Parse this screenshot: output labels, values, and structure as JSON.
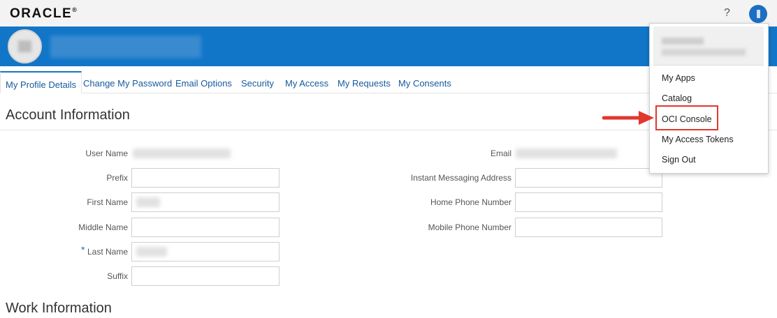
{
  "header": {
    "logo_text": "ORACLE",
    "logo_mark": "®",
    "help_label": "?"
  },
  "tabs": [
    {
      "label": "My Profile Details",
      "active": true
    },
    {
      "label": "Change My Password"
    },
    {
      "label": "Email Options"
    },
    {
      "label": "Security"
    },
    {
      "label": "My Access"
    },
    {
      "label": "My Requests"
    },
    {
      "label": "My Consents"
    }
  ],
  "sections": {
    "account": "Account Information",
    "work": "Work Information"
  },
  "form": {
    "left": [
      {
        "label": "User Name"
      },
      {
        "label": "Prefix"
      },
      {
        "label": "First Name"
      },
      {
        "label": "Middle Name"
      },
      {
        "label": "Last Name",
        "required": true
      },
      {
        "label": "Suffix"
      }
    ],
    "right": [
      {
        "label": "Email"
      },
      {
        "label": "Instant Messaging Address"
      },
      {
        "label": "Home Phone Number"
      },
      {
        "label": "Mobile Phone Number"
      }
    ],
    "required_mark": "*"
  },
  "menu": {
    "items": [
      "My Apps",
      "Catalog",
      "OCI Console",
      "My Access Tokens",
      "Sign Out"
    ],
    "highlighted": "OCI Console"
  },
  "colors": {
    "brand_blue": "#1176c8",
    "highlight_red": "#e2372c",
    "link_blue": "#155a9c"
  }
}
